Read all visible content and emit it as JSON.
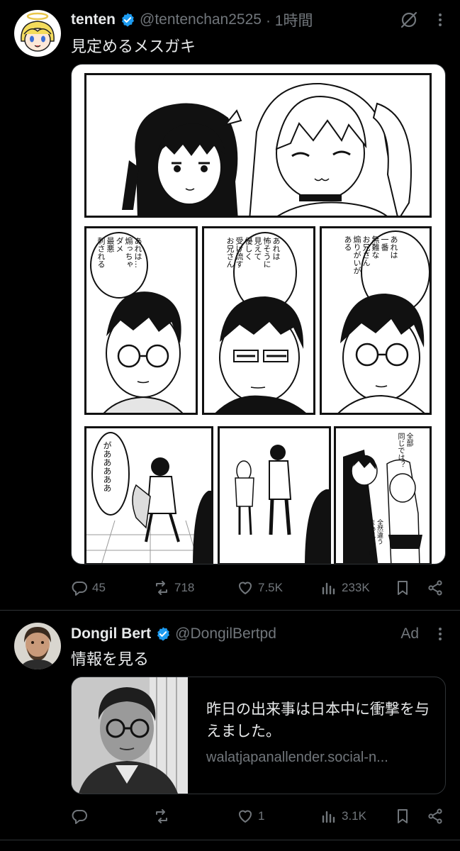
{
  "tweet1": {
    "name": "tenten",
    "handle": "@tentenchan2525",
    "time": "· 1時間",
    "text": "見定めるメスガキ",
    "manga": {
      "bubble_right": "あれは\n一番\n無難な\nお兄さん\n煽りがいが\nある",
      "bubble_middle": "あれは\n怖そうに\n見えて\n優しく\n受け流す\nお兄さん",
      "bubble_left": "あれは…\n煽っちゃ\nダメ\n最悪\n刺される",
      "bubble_scream": "があああああ",
      "bubble_same": "全部\n同じでは？",
      "bubble_diff": "全然違う\nまぁ見とけ♡"
    },
    "stats": {
      "replies": "45",
      "reposts": "718",
      "likes": "7.5K",
      "views": "233K"
    }
  },
  "tweet2": {
    "name": "Dongil Bert",
    "handle": "@DongilBertpd",
    "ad_label": "Ad",
    "text": "情報を見る",
    "card": {
      "title": "昨日の出来事は日本中に衝撃を与えました。",
      "url": "walatjapanallender.social-n..."
    },
    "stats": {
      "replies": "",
      "reposts": "",
      "likes": "1",
      "views": "3.1K"
    }
  },
  "colors": {
    "background": "#000000",
    "text": "#e7e9ea",
    "muted": "#71767b",
    "verified": "#1d9bf0",
    "divider": "#2f3336"
  },
  "icons": [
    "verified-icon",
    "grok-icon",
    "more-icon",
    "reply-icon",
    "repost-icon",
    "like-icon",
    "views-icon",
    "bookmark-icon",
    "share-icon"
  ]
}
